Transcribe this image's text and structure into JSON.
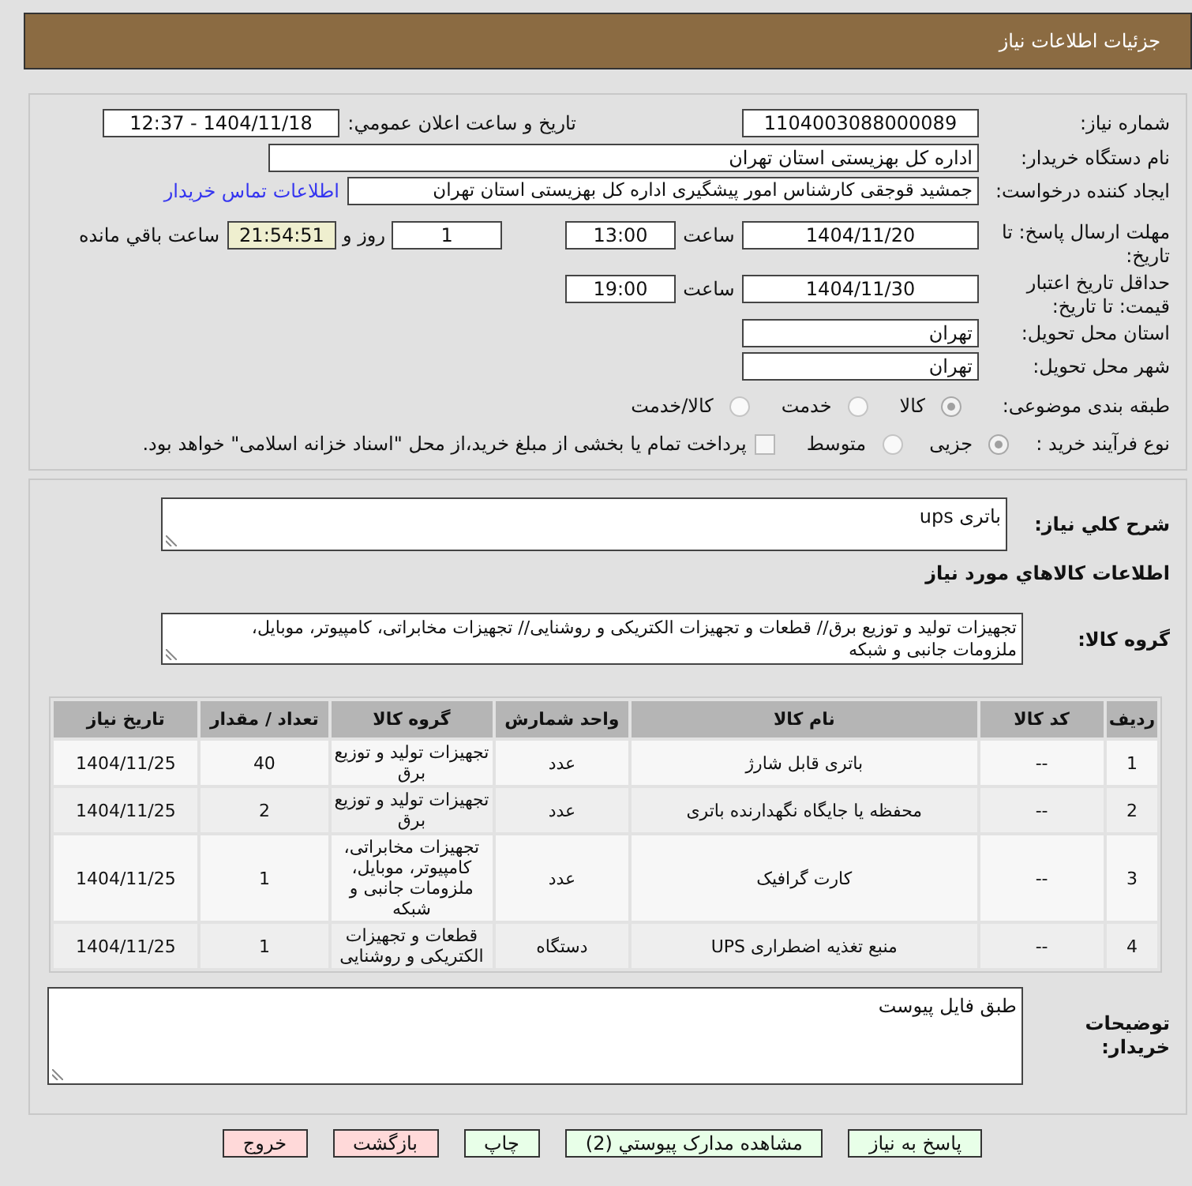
{
  "header": {
    "title": "جزئیات اطلاعات نیاز"
  },
  "need_number": {
    "label": "شماره نیاز:",
    "value": "1104003088000089"
  },
  "announcement": {
    "label": "تاریخ و ساعت اعلان عمومي:",
    "value": "1404/11/18 - 12:37"
  },
  "buyer_org": {
    "label": "نام دستگاه خریدار:",
    "value": "اداره کل بهزیستی استان تهران"
  },
  "requester": {
    "label": "ایجاد کننده درخواست:",
    "value": "جمشید قوجقی کارشناس امور پیشگیری اداره کل بهزیستی استان تهران",
    "contact_link": "اطلاعات تماس خریدار"
  },
  "reply_deadline": {
    "label": "مهلت ارسال پاسخ: تا تاریخ:",
    "date": "1404/11/20",
    "time_label": "ساعت",
    "time": "13:00",
    "days": "1",
    "days_label": "روز و",
    "remaining": "21:54:51",
    "remaining_label": "ساعت باقي مانده"
  },
  "price_validity": {
    "label": "حداقل تاریخ اعتبار قیمت: تا تاریخ:",
    "date": "1404/11/30",
    "time_label": "ساعت",
    "time": "19:00"
  },
  "delivery_province": {
    "label": "استان محل تحویل:",
    "value": "تهران"
  },
  "delivery_city": {
    "label": "شهر محل تحویل:",
    "value": "تهران"
  },
  "category": {
    "label": "طبقه بندی موضوعی:",
    "options": [
      {
        "label": "کالا",
        "selected": true
      },
      {
        "label": "خدمت",
        "selected": false
      },
      {
        "label": "کالا/خدمت",
        "selected": false
      }
    ]
  },
  "purchase_process": {
    "label": "نوع فرآیند خرید :",
    "options": [
      {
        "label": "جزیی",
        "selected": true
      },
      {
        "label": "متوسط",
        "selected": false
      }
    ],
    "treasury_option": {
      "label": "پرداخت تمام یا بخشی از مبلغ خرید،از محل \"اسناد خزانه اسلامی\" خواهد بود.",
      "checked": false
    }
  },
  "need_description": {
    "label": "شرح کلي نیاز:",
    "value": "باتری ups"
  },
  "goods_section_title": "اطلاعات کالاهاي مورد نیاز",
  "goods_group": {
    "label": "گروه کالا:",
    "value": "تجهیزات تولید و توزیع برق// قطعات و تجهیزات الکتریکی و روشنایی// تجهیزات مخابراتی، کامپیوتر، موبایل، ملزومات جانبی و شبکه"
  },
  "items_table": {
    "columns": [
      "ردیف",
      "کد کالا",
      "نام کالا",
      "واحد شمارش",
      "گروه کالا",
      "تعداد / مقدار",
      "تاریخ نیاز"
    ],
    "rows": [
      [
        "1",
        "--",
        "باتری قابل شارژ",
        "عدد",
        "تجهیزات تولید و توزیع برق",
        "40",
        "1404/11/25"
      ],
      [
        "2",
        "--",
        "محفظه یا جایگاه نگهدارنده باتری",
        "عدد",
        "تجهیزات تولید و توزیع برق",
        "2",
        "1404/11/25"
      ],
      [
        "3",
        "--",
        "کارت گرافیک",
        "عدد",
        "تجهیزات مخابراتی، کامپیوتر، موبایل، ملزومات جانبی و شبکه",
        "1",
        "1404/11/25"
      ],
      [
        "4",
        "--",
        "منبع تغذیه اضطراری UPS",
        "دستگاه",
        "قطعات و تجهیزات الکتریکی و روشنایی",
        "1",
        "1404/11/25"
      ]
    ]
  },
  "buyer_notes": {
    "label": "توضیحات خریدار:",
    "value": "طبق فایل پیوست"
  },
  "buttons": [
    {
      "label": "پاسخ به نیاز",
      "kind": "action"
    },
    {
      "label": "مشاهده مدارک پیوستي (2)",
      "kind": "action"
    },
    {
      "label": "چاپ",
      "kind": "action"
    },
    {
      "label": "بازگشت",
      "kind": "exit"
    },
    {
      "label": "خروج",
      "kind": "exit"
    }
  ]
}
